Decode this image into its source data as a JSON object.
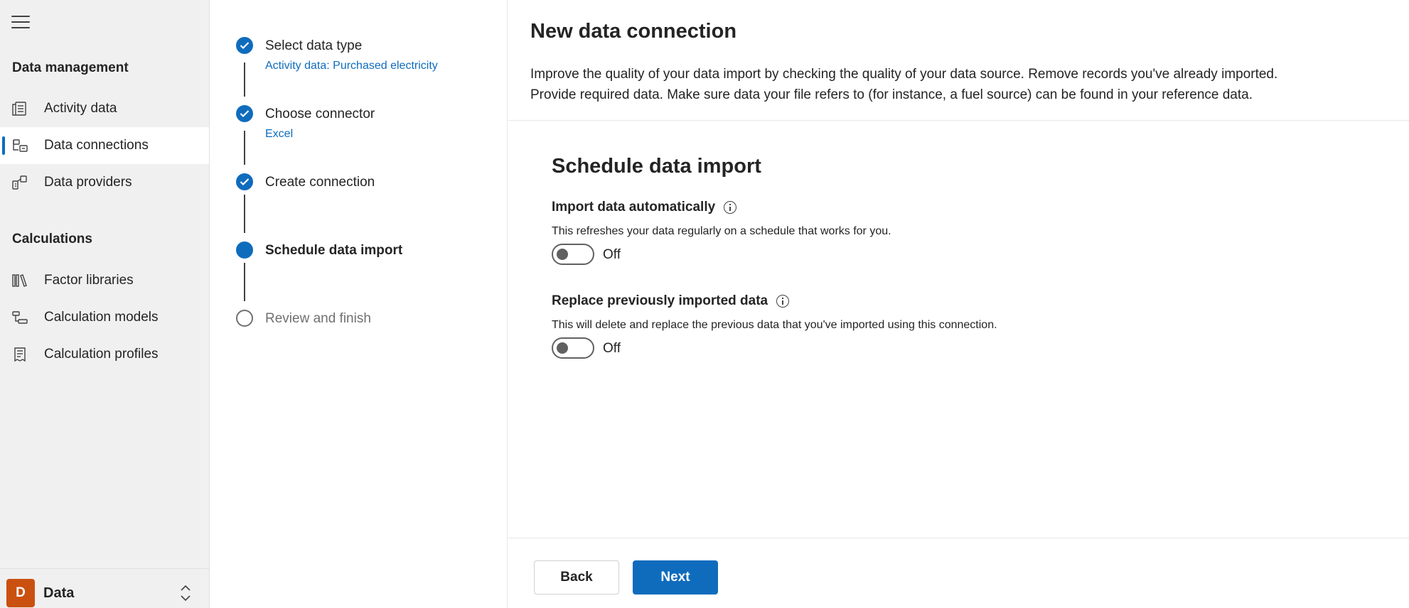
{
  "nav": {
    "menu_icon": "hamburger-icon",
    "sections": [
      {
        "title": "Data management",
        "items": [
          {
            "label": "Activity data",
            "icon": "document-table-icon",
            "active": false
          },
          {
            "label": "Data connections",
            "icon": "database-link-icon",
            "active": true
          },
          {
            "label": "Data providers",
            "icon": "data-providers-icon",
            "active": false
          }
        ]
      },
      {
        "title": "Calculations",
        "items": [
          {
            "label": "Factor libraries",
            "icon": "library-icon",
            "active": false
          },
          {
            "label": "Calculation models",
            "icon": "flowchart-icon",
            "active": false
          },
          {
            "label": "Calculation profiles",
            "icon": "receipt-icon",
            "active": false
          }
        ]
      }
    ],
    "footer": {
      "avatar_letter": "D",
      "label": "Data",
      "avatar_color": "#ca5010"
    }
  },
  "stepper": {
    "steps": [
      {
        "title": "Select data type",
        "subtitle": "Activity data: Purchased electricity",
        "state": "done"
      },
      {
        "title": "Choose connector",
        "subtitle": "Excel",
        "state": "done"
      },
      {
        "title": "Create connection",
        "subtitle": "",
        "state": "done"
      },
      {
        "title": "Schedule data import",
        "subtitle": "",
        "state": "current"
      },
      {
        "title": "Review and finish",
        "subtitle": "",
        "state": "pending"
      }
    ]
  },
  "main": {
    "title": "New data connection",
    "description_line1": "Improve the quality of your data import by checking the quality of your data source. Remove records you've already imported.",
    "description_line2": "Provide required data. Make sure data your file refers to (for instance, a fuel source) can be found in your reference data.",
    "section_title": "Schedule data import",
    "fields": [
      {
        "label": "Import data automatically",
        "help": "This refreshes your data regularly on a schedule that works for you.",
        "toggle_state": "Off"
      },
      {
        "label": "Replace previously imported data",
        "help": "This will delete and replace the previous data that you've imported using this connection.",
        "toggle_state": "Off"
      }
    ],
    "buttons": {
      "back": "Back",
      "next": "Next"
    }
  },
  "colors": {
    "accent": "#0f6cbd",
    "nav_bg": "#f0f0f0"
  }
}
